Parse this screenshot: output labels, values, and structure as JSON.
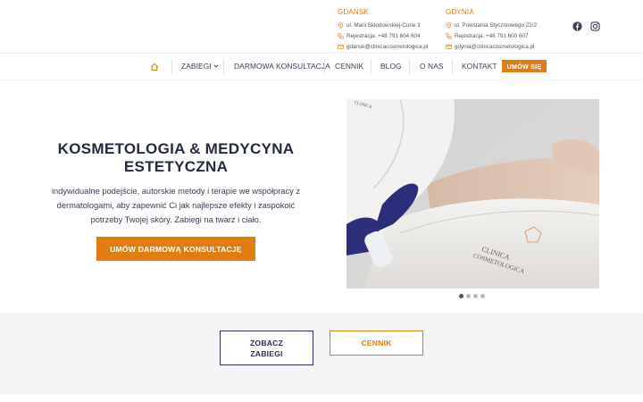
{
  "brand": {
    "accent": "#e07d10",
    "navy": "#2e2f68"
  },
  "locations": [
    {
      "city": "GDAŃSK",
      "address": "ul. Marii Skłodowskiej-Curie 3",
      "phone": "Rejestracja: +48 791 604 604",
      "email": "gdansk@clinicacosmetologica.pl"
    },
    {
      "city": "GDYNIA",
      "address": "ul. Powstania Styczniowego 22/2",
      "phone": "Rejestracja: +48 791 600 607",
      "email": "gdynia@clinicacosmetologica.pl"
    }
  ],
  "social": {
    "facebook_icon": "facebook-icon",
    "instagram_icon": "instagram-icon"
  },
  "nav": {
    "home_icon": "home-icon",
    "items": [
      "ZABIEGI",
      "DARMOWA KONSULTACJA",
      "CENNIK",
      "BLOG",
      "O NAS",
      "KONTAKT"
    ],
    "cta": "UMÓW SIĘ"
  },
  "hero": {
    "title": "KOSMETOLOGIA & MEDYCYNA ESTETYCZNA",
    "text": "indywidualne podejście, autorskie metody i terapie we współpracy z dermatologami, aby zapewnić Ci jak najlepsze efekty i zaspokoić potrzeby Twojej skóry. Zabiegi na twarz i ciało.",
    "cta": "UMÓW DARMOWĄ KONSULTACJĘ",
    "image_text_1": "CLINICA",
    "image_text_2": "COSMETOLOGICA",
    "slides": 4,
    "active_slide": 1
  },
  "lower": {
    "btn_zabiegi_line1": "ZOBACZ",
    "btn_zabiegi_line2": "ZABIEGI",
    "btn_cennik": "CENNIK"
  }
}
